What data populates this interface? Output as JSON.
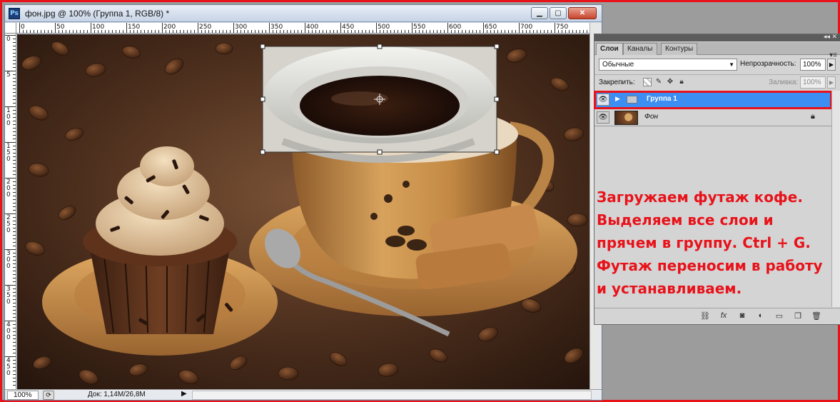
{
  "window": {
    "ps_icon": "Ps",
    "title": "фон.jpg @ 100% (Группа 1, RGB/8) *",
    "minimize": "▁",
    "maximize": "▢",
    "close": "✕"
  },
  "ruler": {
    "h_labels": [
      "0",
      "50",
      "100",
      "150",
      "200",
      "250",
      "300",
      "350",
      "400",
      "450",
      "500",
      "550",
      "600",
      "650",
      "700",
      "750"
    ],
    "v_labels": [
      "0",
      "5",
      "1 0 0",
      "1 5 0",
      "2 0 0",
      "2 5 0",
      "3 0 0",
      "3 5 0",
      "4 0 0",
      "4 5 0"
    ]
  },
  "status": {
    "zoom": "100%",
    "doc_size": "Док: 1,14M/26,8M",
    "arrow": "▶"
  },
  "panel": {
    "tabs": [
      "Слои",
      "Каналы",
      "Контуры"
    ],
    "collapse_arrows": "◂◂ ✕",
    "menu": "▾≡",
    "blend_mode": "Обычные",
    "opacity_label": "Непрозрачность:",
    "opacity_value": "100%",
    "lock_label": "Закрепить:",
    "fill_label": "Заливка:",
    "fill_value": "100%",
    "layers": [
      {
        "name": "Группа 1",
        "type": "group",
        "selected": true
      },
      {
        "name": "Фон",
        "type": "background",
        "locked": true
      }
    ],
    "annotation": "Загружаем футаж кофе. Выделяем все слои и прячем в группу. Ctrl + G. Футаж переносим в работу и устанавливаем."
  },
  "colors": {
    "highlight": "#e8121a",
    "selection": "#3d8ef2"
  }
}
